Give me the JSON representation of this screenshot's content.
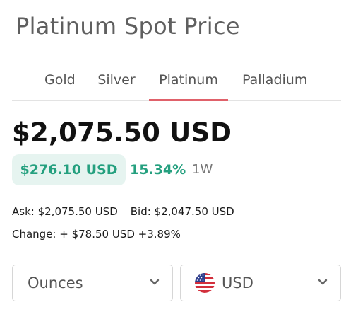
{
  "header": {
    "title": "Platinum Spot Price"
  },
  "tabs": [
    {
      "label": "Gold",
      "active": false
    },
    {
      "label": "Silver",
      "active": false
    },
    {
      "label": "Platinum",
      "active": true
    },
    {
      "label": "Palladium",
      "active": false
    }
  ],
  "price": {
    "value": "$2,075.50 USD"
  },
  "change": {
    "amount": "$276.10 USD",
    "percent": "15.34%",
    "period": "1W"
  },
  "details": {
    "ask": "Ask: $2,075.50 USD",
    "bid": "Bid: $2,047.50 USD",
    "change": "Change: + $78.50 USD +3.89%"
  },
  "selectors": {
    "units": {
      "value": "Ounces",
      "icon": "chevron-down-icon"
    },
    "currency": {
      "value": "USD",
      "icon": "us-flag-icon"
    }
  },
  "colors": {
    "accent_positive": "#25a07f",
    "tab_underline": "#e0616a",
    "pill_background": "#e6f4f0"
  }
}
